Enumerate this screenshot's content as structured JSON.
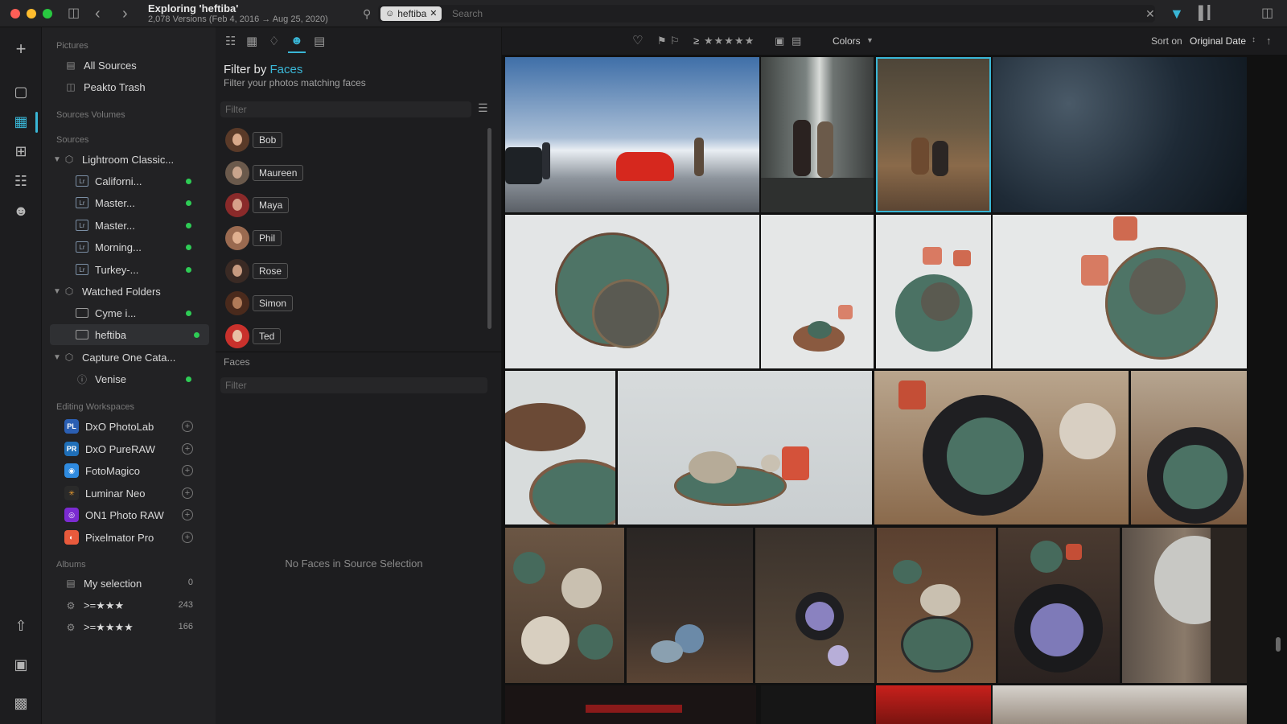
{
  "window": {
    "title": "Exploring 'heftiba'",
    "subtitle": "2,078 Versions (Feb 4, 2016 → Aug 25, 2020)"
  },
  "search": {
    "token": "heftiba",
    "placeholder": "Search"
  },
  "sidebar": {
    "pictures_header": "Pictures",
    "all_sources": "All Sources",
    "trash": "Peakto Trash",
    "sources_volumes_header": "Sources Volumes",
    "sources_header": "Sources",
    "lightroom": {
      "label": "Lightroom Classic...",
      "children": [
        "Californi...",
        "Master...",
        "Master...",
        "Morning...",
        "Turkey-..."
      ]
    },
    "watched": {
      "label": "Watched Folders",
      "children": [
        "Cyme i...",
        "heftiba"
      ]
    },
    "capture": {
      "label": "Capture One Cata...",
      "children": [
        "Venise"
      ]
    },
    "editing_header": "Editing Workspaces",
    "apps": [
      {
        "label": "DxO PhotoLab",
        "badge": "PL",
        "color": "#2b5fb3"
      },
      {
        "label": "DxO PureRAW",
        "badge": "PR",
        "color": "#1f6fb8"
      },
      {
        "label": "FotoMagico",
        "badge": "◉",
        "color": "#2f8be0"
      },
      {
        "label": "Luminar Neo",
        "badge": "✳",
        "color": "#2a2a2a"
      },
      {
        "label": "ON1 Photo RAW",
        "badge": "◎",
        "color": "#7b2bd1"
      },
      {
        "label": "Pixelmator Pro",
        "badge": "◐",
        "color": "#e85a3c"
      }
    ],
    "albums_header": "Albums",
    "albums": [
      {
        "label": "My selection",
        "count": "0"
      },
      {
        "label": ">=★★★",
        "count": "243"
      },
      {
        "label": ">=★★★★",
        "count": "166"
      }
    ]
  },
  "filter_panel": {
    "title_prefix": "Filter by ",
    "title_accent": "Faces",
    "subtitle": "Filter your photos matching faces",
    "filter_placeholder": "Filter",
    "faces": [
      "Bob",
      "Maureen",
      "Maya",
      "Phil",
      "Rose",
      "Simon",
      "Ted"
    ],
    "faces_header": "Faces",
    "faces_filter_placeholder": "Filter",
    "empty_message": "No Faces in Source Selection"
  },
  "grid_toolbar": {
    "rating_prefix": "≥",
    "colors_label": "Colors",
    "sort_label": "Sort on",
    "sort_value": "Original Date"
  },
  "colors": {
    "accent": "#39b6d6",
    "status_online": "#2ecc55"
  }
}
